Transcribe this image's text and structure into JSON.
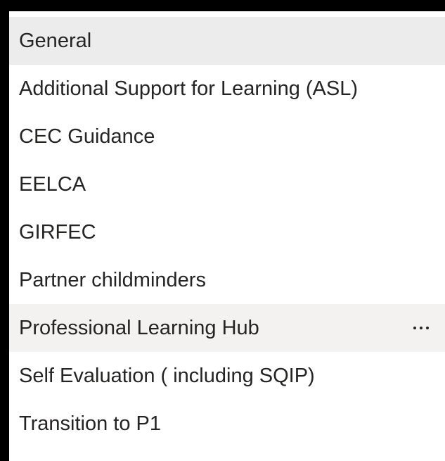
{
  "channels": {
    "items": [
      {
        "label": "General",
        "state": "selected"
      },
      {
        "label": "Additional Support for Learning (ASL)"
      },
      {
        "label": "CEC Guidance"
      },
      {
        "label": "EELCA"
      },
      {
        "label": "GIRFEC"
      },
      {
        "label": "Partner childminders"
      },
      {
        "label": "Professional Learning Hub",
        "state": "hovered",
        "more_icon": "more-options-icon"
      },
      {
        "label": "Self Evaluation ( including SQIP)"
      },
      {
        "label": "Transition to P1"
      }
    ]
  },
  "colors": {
    "frame": "#000000",
    "panel_background": "#ffffff",
    "selected_background": "#ececec",
    "hover_background": "#f3f2f1",
    "text": "#252423"
  }
}
